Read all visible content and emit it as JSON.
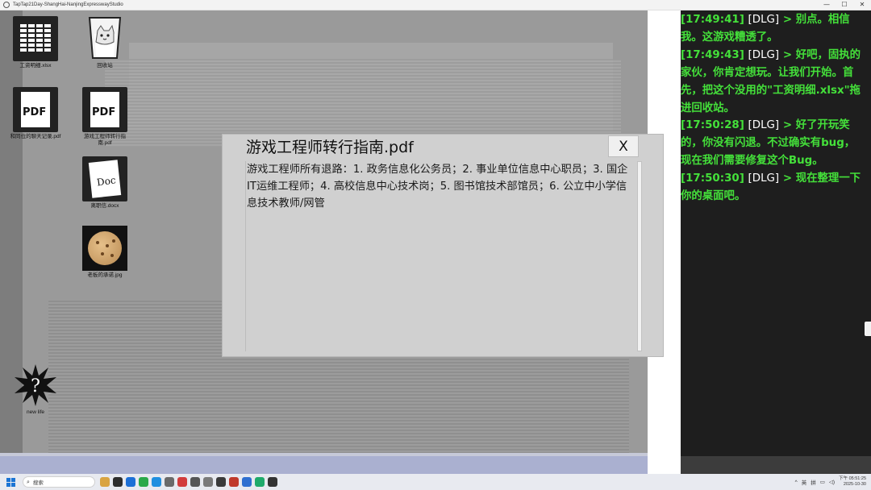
{
  "window": {
    "title": "TapTap21Day-ShangHai-NanjingExpresswayStudio",
    "minimize": "—",
    "maximize": "☐",
    "close": "✕"
  },
  "desktop_icons": [
    {
      "label": "工资明细.xlsx",
      "icon": "spreadsheet-icon"
    },
    {
      "label": "回收站",
      "icon": "recycle-bin-icon"
    },
    {
      "label": "和同位的聊天记录.pdf",
      "icon": "pdf-file-icon"
    },
    {
      "label": "游戏工程师转行指南.pdf",
      "icon": "pdf-file-icon"
    },
    {
      "label": "离职信.docx",
      "icon": "doc-file-icon"
    },
    {
      "label": "老板的承诺.jpg",
      "icon": "image-file-icon"
    },
    {
      "label": "new life",
      "icon": "question-burst-icon"
    }
  ],
  "icon_glyphs": {
    "pdf": "PDF",
    "doc": "Doc"
  },
  "dialog": {
    "title": "游戏工程师转行指南.pdf",
    "close_label": "X",
    "content": "游戏工程师所有退路：1. 政务信息化公务员；2. 事业单位信息中心职员；3. 国企IT运维工程师；4. 高校信息中心技术岗；5. 图书馆技术部馆员；6. 公立中小学信息技术教师/网管"
  },
  "log": {
    "lines": [
      {
        "time": "[17:49:41]",
        "tag": "[DLG]",
        "text": "> 别点。相信我。这游戏糟透了。"
      },
      {
        "time": "[17:49:43]",
        "tag": "[DLG]",
        "text": "> 好吧，固执的家伙，你肯定想玩。让我们开始。首先，把这个没用的\"工资明细.xlsx\"拖进回收站。"
      },
      {
        "time": "[17:50:28]",
        "tag": "[DLG]",
        "text": "> 好了开玩笑的，你没有闪退。不过确实有bug，现在我们需要修复这个Bug。"
      },
      {
        "time": "[17:50:30]",
        "tag": "[DLG]",
        "text": "> 现在整理一下你的桌面吧。"
      }
    ]
  },
  "taskbar": {
    "search_placeholder": "搜索",
    "apps": [
      "#d9a441",
      "#2d2d2d",
      "#1d6fd6",
      "#2aa84a",
      "#1f8fe0",
      "#6a6a6a",
      "#d23c3c",
      "#555555",
      "#7a7a7a",
      "#3a3a3a",
      "#c0392b",
      "#2f6fd0",
      "#1faa6b",
      "#333333"
    ],
    "tray": {
      "chevron": "^",
      "ime1": "英",
      "ime2": "拼",
      "time": "下午 05:51:25",
      "date": "2025-10-30"
    }
  }
}
